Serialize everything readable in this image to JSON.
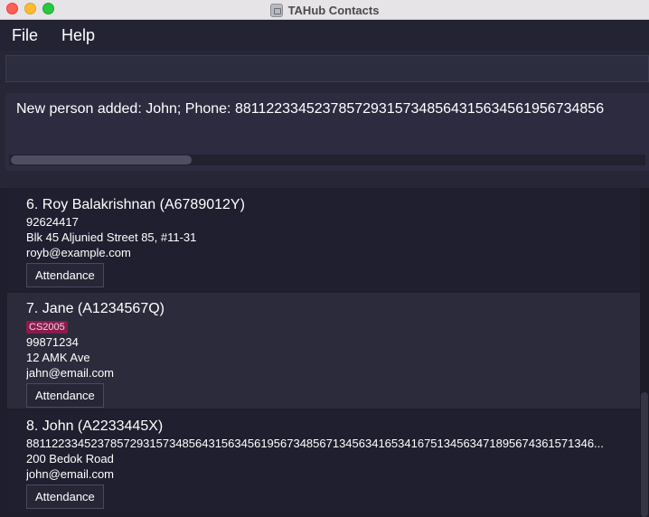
{
  "window": {
    "title": "TAHub Contacts"
  },
  "menu": [
    {
      "label": "File"
    },
    {
      "label": "Help"
    }
  ],
  "command": {
    "value": "",
    "placeholder": ""
  },
  "result": {
    "text": "New person added: John; Phone: 8811223345237857293157348564315634561956734856"
  },
  "persons": [
    {
      "header": "6.  Roy Balakrishnan  (A6789012Y)",
      "tags": [],
      "phone": "92624417",
      "address": "Blk 45 Aljunied Street 85, #11-31",
      "email": "royb@example.com",
      "button_label": "Attendance"
    },
    {
      "header": "7.  Jane  (A1234567Q)",
      "tags": [
        "CS2005"
      ],
      "phone": "99871234",
      "address": "12 AMK Ave",
      "email": "jahn@email.com",
      "button_label": "Attendance"
    },
    {
      "header": "8.  John  (A2233445X)",
      "tags": [],
      "phone": "881122334523785729315734856431563456195673485671345634165341675134563471895674361571346...",
      "address": "200 Bedok Road",
      "email": "john@email.com",
      "button_label": "Attendance"
    }
  ],
  "colors": {
    "background": "#1e1e2c",
    "panel": "#262637",
    "card_alt": "#2c2b3c",
    "tag": "#8a1c4c"
  }
}
